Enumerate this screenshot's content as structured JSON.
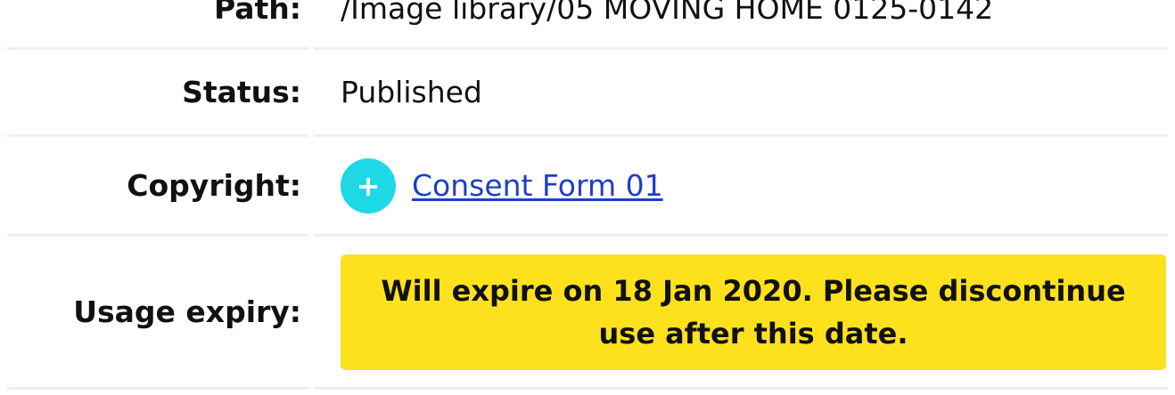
{
  "metadata": {
    "path": {
      "label": "Path:",
      "value": "/Image library/05 MOVING HOME 0125-0142"
    },
    "status": {
      "label": "Status:",
      "value": "Published"
    },
    "copyright": {
      "label": "Copyright:",
      "add_icon": "plus-icon",
      "add_symbol": "+",
      "link_text": "Consent Form 01"
    },
    "usage_expiry": {
      "label": "Usage expiry:",
      "notice": "Will expire on 18 Jan 2020. Please discontinue use after this date."
    }
  },
  "colors": {
    "accent_cyan": "#1fd8e6",
    "warning_yellow": "#fde11d",
    "link_blue": "#1d3fc7"
  }
}
